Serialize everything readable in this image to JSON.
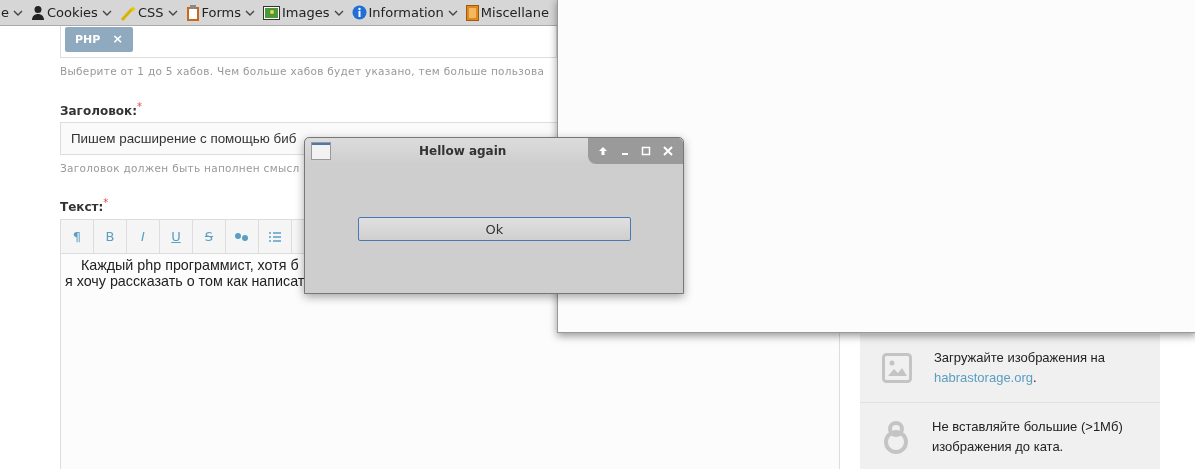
{
  "browser_toolbar": {
    "menus": [
      {
        "label": "e"
      },
      {
        "label": "Cookies"
      },
      {
        "label": "CSS"
      },
      {
        "label": "Forms"
      },
      {
        "label": "Images"
      },
      {
        "label": "Information"
      },
      {
        "label": "Miscellane"
      }
    ]
  },
  "form": {
    "hubs": {
      "tags": [
        "PHP"
      ],
      "remove_glyph": "×",
      "hint": "Выберите от 1 до 5 хабов. Чем больше хабов будет указано, тем больше пользова"
    },
    "title": {
      "label": "Заголовок:",
      "required_mark": "*",
      "value": "Пишем расширение с помощью биб",
      "hint": "Заголовок должен быть наполнен смысл"
    },
    "text": {
      "label": "Текст:",
      "required_mark": "*",
      "tools": [
        {
          "kind": "glyph",
          "label": "¶"
        },
        {
          "kind": "glyph",
          "label": "B"
        },
        {
          "kind": "italic",
          "label": "I"
        },
        {
          "kind": "underline",
          "label": "U"
        },
        {
          "kind": "strike",
          "label": "S"
        },
        {
          "kind": "quote"
        },
        {
          "kind": "list"
        }
      ],
      "lines": [
        "    Каждый php программист, хотя б",
        "я хочу рассказать о том как написат"
      ]
    }
  },
  "sidebar": {
    "items": [
      {
        "text": "Загружайте изображения на ",
        "link": "habrastorage.org",
        "after": "."
      },
      {
        "text": "Не вставляйте большие (>1Мб) изображения до ката."
      }
    ]
  },
  "dialog": {
    "title": "Hellow again",
    "button": "Ok"
  }
}
